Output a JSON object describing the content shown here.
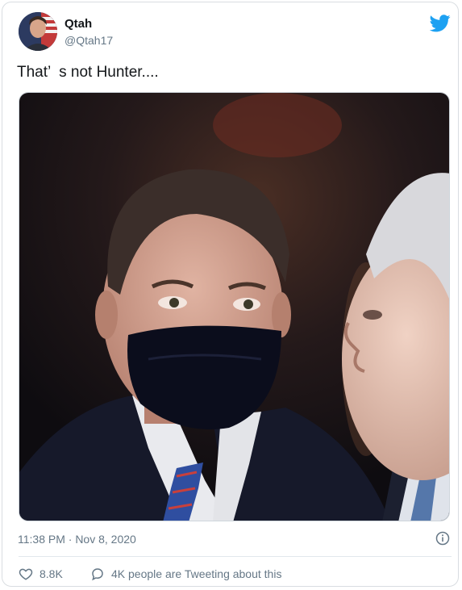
{
  "author": {
    "display_name": "Qtah",
    "handle": "@Qtah17",
    "avatar_icon": "profile-photo-avatar"
  },
  "tweet": {
    "text": "That’  s not Hunter....",
    "media_description_icon": "photo-two-men-masked",
    "timestamp": "11:38 PM · Nov 8, 2020"
  },
  "actions": {
    "like_count": "8.8K",
    "conversation_label": "4K people are Tweeting about this"
  },
  "colors": {
    "twitter_blue": "#1da1f2",
    "text_primary": "#14171a",
    "text_secondary": "#657786"
  }
}
